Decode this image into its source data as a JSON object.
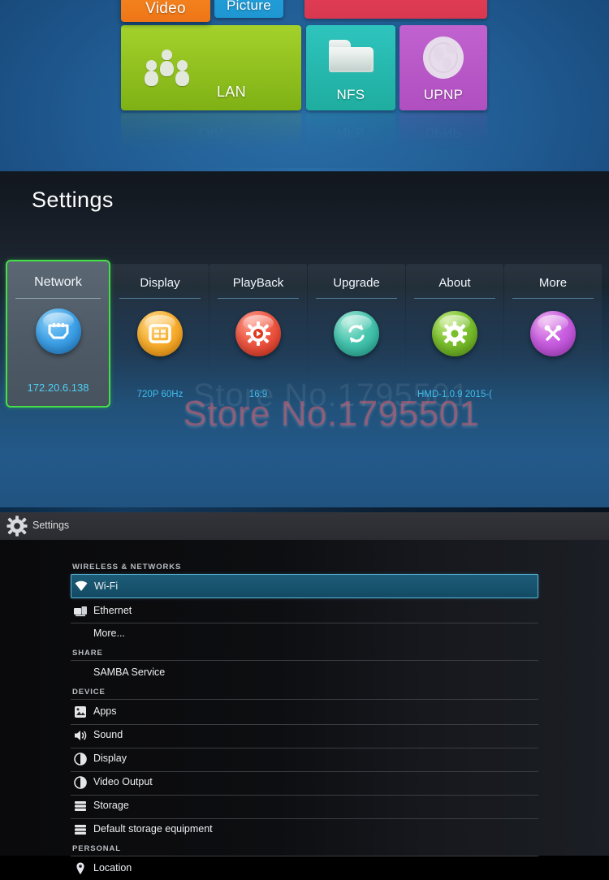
{
  "launcher": {
    "tiles": [
      {
        "id": "video",
        "label": "Video",
        "color": "#f79227"
      },
      {
        "id": "picture",
        "label": "Picture",
        "color": "#27a8e0"
      },
      {
        "id": "red",
        "label": "",
        "color": "#e8415f"
      },
      {
        "id": "lan",
        "label": "LAN",
        "color": "#a4d12b",
        "icon": "people-icon"
      },
      {
        "id": "nfs",
        "label": "NFS",
        "color": "#2ec4be",
        "icon": "folder-icon"
      },
      {
        "id": "upnp",
        "label": "UPNP",
        "color": "#c062cf",
        "icon": "globe-icon"
      }
    ],
    "reflections": [
      "LAN",
      "NFS",
      "UPNP"
    ]
  },
  "tv_settings": {
    "title": "Settings",
    "accent_selected": "#44e048",
    "value_color": "#3fbdec",
    "watermark": "Store No.1795501",
    "watermark_ghost": "Store No.1795501",
    "tabs": [
      {
        "label": "Network",
        "value": "172.20.6.138",
        "icon": "ethernet-port-icon",
        "selected": true
      },
      {
        "label": "Display",
        "value": "720P 60Hz",
        "icon": "monitor-icon",
        "selected": false
      },
      {
        "label": "PlayBack",
        "value": "16:9",
        "icon": "gear-play-icon",
        "selected": false
      },
      {
        "label": "Upgrade",
        "value": "",
        "icon": "refresh-icon",
        "selected": false
      },
      {
        "label": "About",
        "value": "HMD-1.0.9 2015-(",
        "icon": "gear-icon",
        "selected": false
      },
      {
        "label": "More",
        "value": "",
        "icon": "tools-icon",
        "selected": false
      }
    ]
  },
  "android_settings": {
    "app_bar": {
      "title": "Settings",
      "icon": "gear-icon"
    },
    "sections": [
      {
        "header": "WIRELESS & NETWORKS",
        "items": [
          {
            "label": "Wi-Fi",
            "icon": "wifi-icon",
            "selected": true
          },
          {
            "label": "Ethernet",
            "icon": "ethernet-icon",
            "selected": false
          },
          {
            "label": "More...",
            "icon": "",
            "selected": false
          }
        ]
      },
      {
        "header": "SHARE",
        "items": [
          {
            "label": "SAMBA Service",
            "icon": "",
            "selected": false
          }
        ]
      },
      {
        "header": "DEVICE",
        "items": [
          {
            "label": "Apps",
            "icon": "apps-icon",
            "selected": false
          },
          {
            "label": "Sound",
            "icon": "sound-icon",
            "selected": false
          },
          {
            "label": "Display",
            "icon": "display-icon",
            "selected": false
          },
          {
            "label": "Video Output",
            "icon": "display-icon",
            "selected": false
          },
          {
            "label": "Storage",
            "icon": "storage-icon",
            "selected": false
          },
          {
            "label": "Default storage equipment",
            "icon": "storage-icon",
            "selected": false
          }
        ]
      },
      {
        "header": "PERSONAL",
        "items": [
          {
            "label": "Location",
            "icon": "location-pin-icon",
            "selected": false
          }
        ]
      }
    ]
  }
}
